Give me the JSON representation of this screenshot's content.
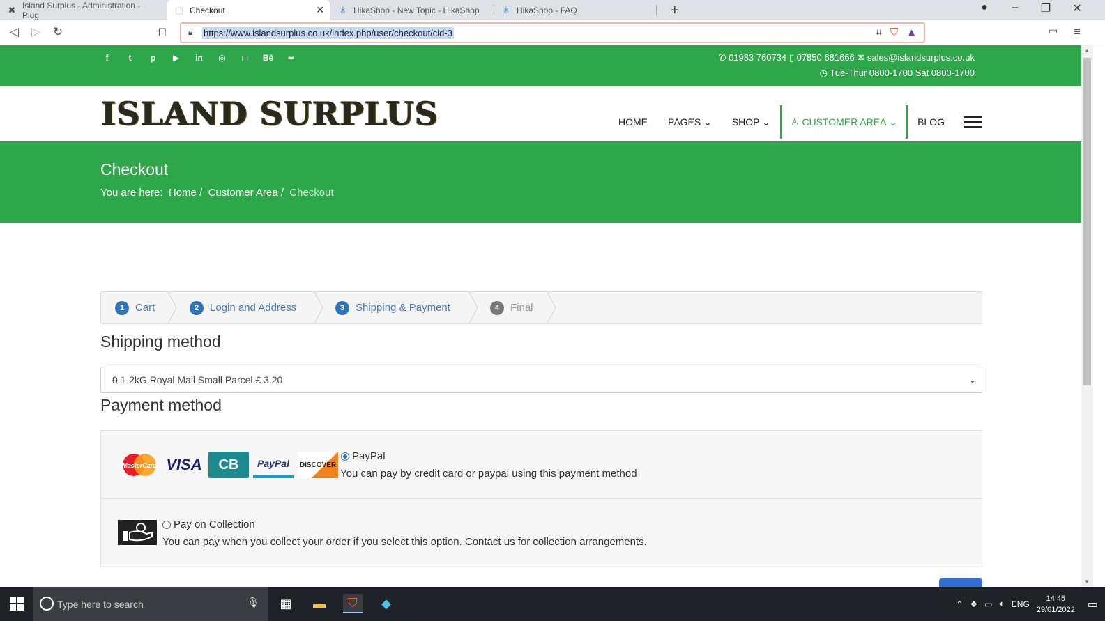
{
  "browser": {
    "tabs": [
      {
        "title": "Island Surplus - Administration - Plug",
        "active": false
      },
      {
        "title": "Checkout",
        "active": true
      },
      {
        "title": "HikaShop - New Topic - HikaShop",
        "active": false
      },
      {
        "title": "HikaShop - FAQ",
        "active": false
      }
    ],
    "url": "https://www.islandsurplus.co.uk/index.php/user/checkout/cid-3"
  },
  "topbar": {
    "social_icons": [
      "facebook-icon",
      "twitter-icon",
      "pinterest-icon",
      "youtube-icon",
      "linkedin-icon",
      "dribbble-icon",
      "instagram-icon",
      "behance-icon",
      "flickr-icon"
    ],
    "phone1": "01983 760734",
    "phone2": "07850 681666",
    "email": "sales@islandsurplus.co.uk",
    "hours": "Tue-Thur 0800-1700 Sat 0800-1700"
  },
  "header": {
    "logo": "ISLAND SURPLUS",
    "nav": {
      "home": "HOME",
      "pages": "PAGES",
      "shop": "SHOP",
      "customer_area": "CUSTOMER AREA",
      "blog": "BLOG"
    }
  },
  "banner": {
    "title": "Checkout",
    "crumb_prefix": "You are here:",
    "crumbs": [
      "Home",
      "Customer Area",
      "Checkout"
    ]
  },
  "steps": [
    {
      "num": "1",
      "label": "Cart"
    },
    {
      "num": "2",
      "label": "Login and Address"
    },
    {
      "num": "3",
      "label": "Shipping & Payment"
    },
    {
      "num": "4",
      "label": "Final"
    }
  ],
  "shipping": {
    "heading": "Shipping method",
    "selected": "0.1-2kG Royal Mail Small Parcel £ 3.20"
  },
  "payment": {
    "heading": "Payment method",
    "methods": [
      {
        "name": "PayPal",
        "description": "You can pay by credit card or paypal using this payment method",
        "selected": true,
        "logos": [
          "MasterCard",
          "VISA",
          "CB",
          "PayPal",
          "DISCOVER"
        ]
      },
      {
        "name": "Pay on Collection",
        "description": "You can pay when you collect your order if you select this option. Contact us for collection arrangements.",
        "selected": false
      }
    ]
  },
  "taskbar": {
    "search_placeholder": "Type here to search",
    "language": "ENG",
    "time": "14:45",
    "date": "29/01/2022"
  }
}
